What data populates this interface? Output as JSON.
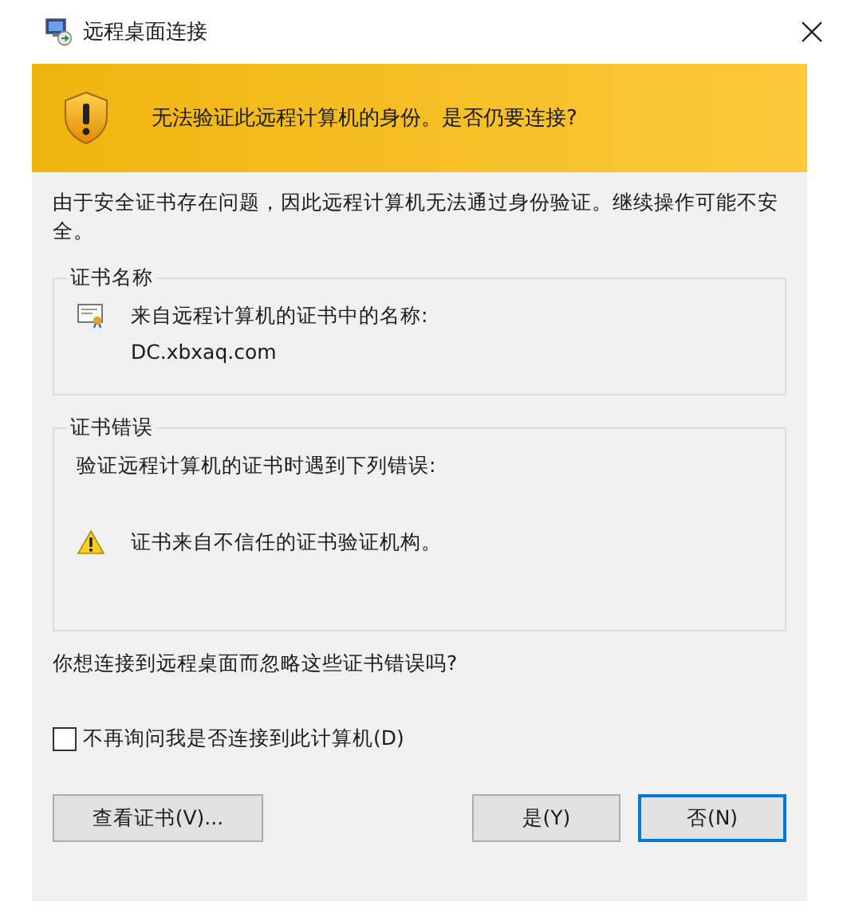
{
  "window": {
    "title": "远程桌面连接"
  },
  "banner": {
    "message": "无法验证此远程计算机的身份。是否仍要连接?"
  },
  "intro": "由于安全证书存在问题，因此远程计算机无法通过身份验证。继续操作可能不安全。",
  "groups": [
    {
      "title": "证书名称",
      "lines": [
        {
          "kind": "certificate",
          "text": "来自远程计算机的证书中的名称:"
        },
        {
          "kind": "plain",
          "text": "DC.xbxaq.com"
        }
      ]
    },
    {
      "title": "证书错误",
      "lines": [
        {
          "kind": "plain",
          "text": "验证远程计算机的证书时遇到下列错误:"
        },
        {
          "kind": "warning",
          "text": "证书来自不信任的证书验证机构。"
        }
      ]
    }
  ],
  "question": "你想连接到远程桌面而忽略这些证书错误吗?",
  "checkbox": {
    "label": "不再询问我是否连接到此计算机(D)",
    "checked": false
  },
  "buttons": [
    {
      "label": "查看证书(V)...",
      "selected": false
    },
    {
      "label": "是(Y)",
      "selected": false
    },
    {
      "label": "否(N)",
      "selected": true
    }
  ]
}
